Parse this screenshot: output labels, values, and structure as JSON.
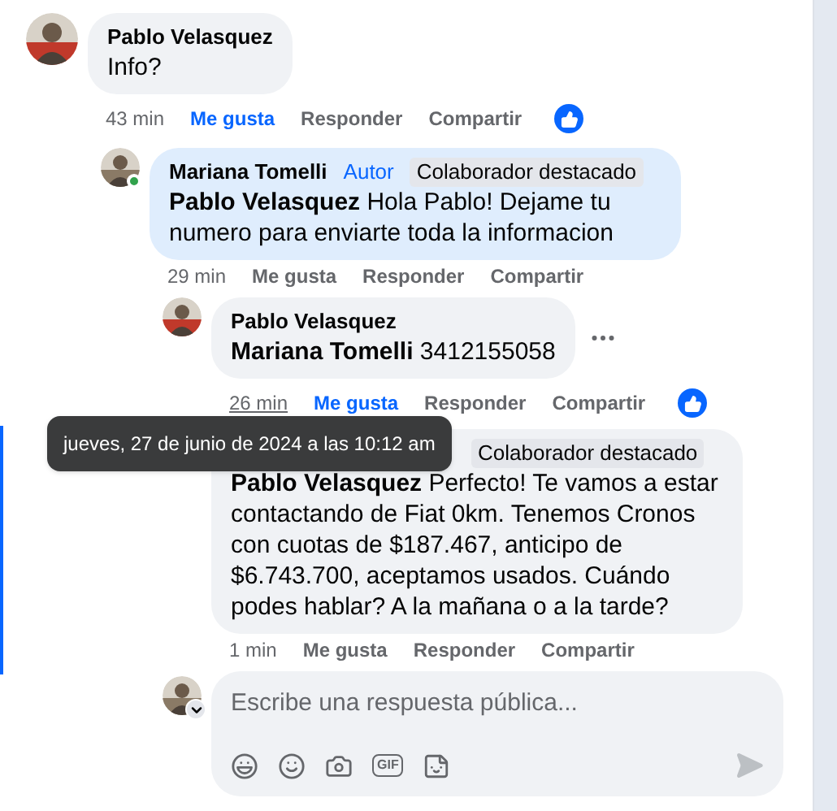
{
  "comments": [
    {
      "author": "Pablo Velasquez",
      "text": "Info?",
      "time": "43 min",
      "time_hovered": false,
      "liked": true,
      "reaction": true,
      "highlighted": false,
      "online": false,
      "more_menu": false,
      "actions": {
        "like": "Me gusta",
        "reply": "Responder",
        "share": "Compartir"
      },
      "children": [
        {
          "author": "Mariana Tomelli",
          "text": "**Pablo Velasquez** Hola Pablo! Dejame tu numero para enviarte toda la informacion",
          "time": "29 min",
          "time_hovered": false,
          "liked": false,
          "reaction": false,
          "highlighted": true,
          "online": true,
          "more_menu": false,
          "badges": [
            {
              "kind": "author",
              "label": "Autor"
            },
            {
              "kind": "featured",
              "label": "Colaborador destacado"
            }
          ],
          "actions": {
            "like": "Me gusta",
            "reply": "Responder",
            "share": "Compartir"
          },
          "children": [
            {
              "author": "Pablo Velasquez",
              "text": "**Mariana Tomelli** 3412155058",
              "time": "26 min",
              "time_hovered": true,
              "liked": true,
              "reaction": true,
              "highlighted": false,
              "online": false,
              "more_menu": true,
              "actions": {
                "like": "Me gusta",
                "reply": "Responder",
                "share": "Compartir"
              }
            },
            {
              "text": "**Pablo Velasquez** Perfecto! Te vamos a estar contactando de Fiat 0km. Tenemos Cronos con cuotas de $187.467, anticipo de $6.743.700, aceptamos usados. Cuándo podes hablar? A la mañana o a la tarde?",
              "time": "1 min",
              "time_hovered": false,
              "liked": false,
              "reaction": false,
              "highlighted": false,
              "more_menu": false,
              "badges": [
                {
                  "kind": "featured",
                  "label": "Colaborador destacado"
                }
              ],
              "actions": {
                "like": "Me gusta",
                "reply": "Responder",
                "share": "Compartir"
              }
            }
          ],
          "reply_box": {
            "placeholder": "Escribe una respuesta pública...",
            "gif_label": "GIF"
          }
        }
      ]
    }
  ],
  "tooltip": {
    "text": "jueves, 27 de junio de 2024 a las 10:12 am"
  }
}
